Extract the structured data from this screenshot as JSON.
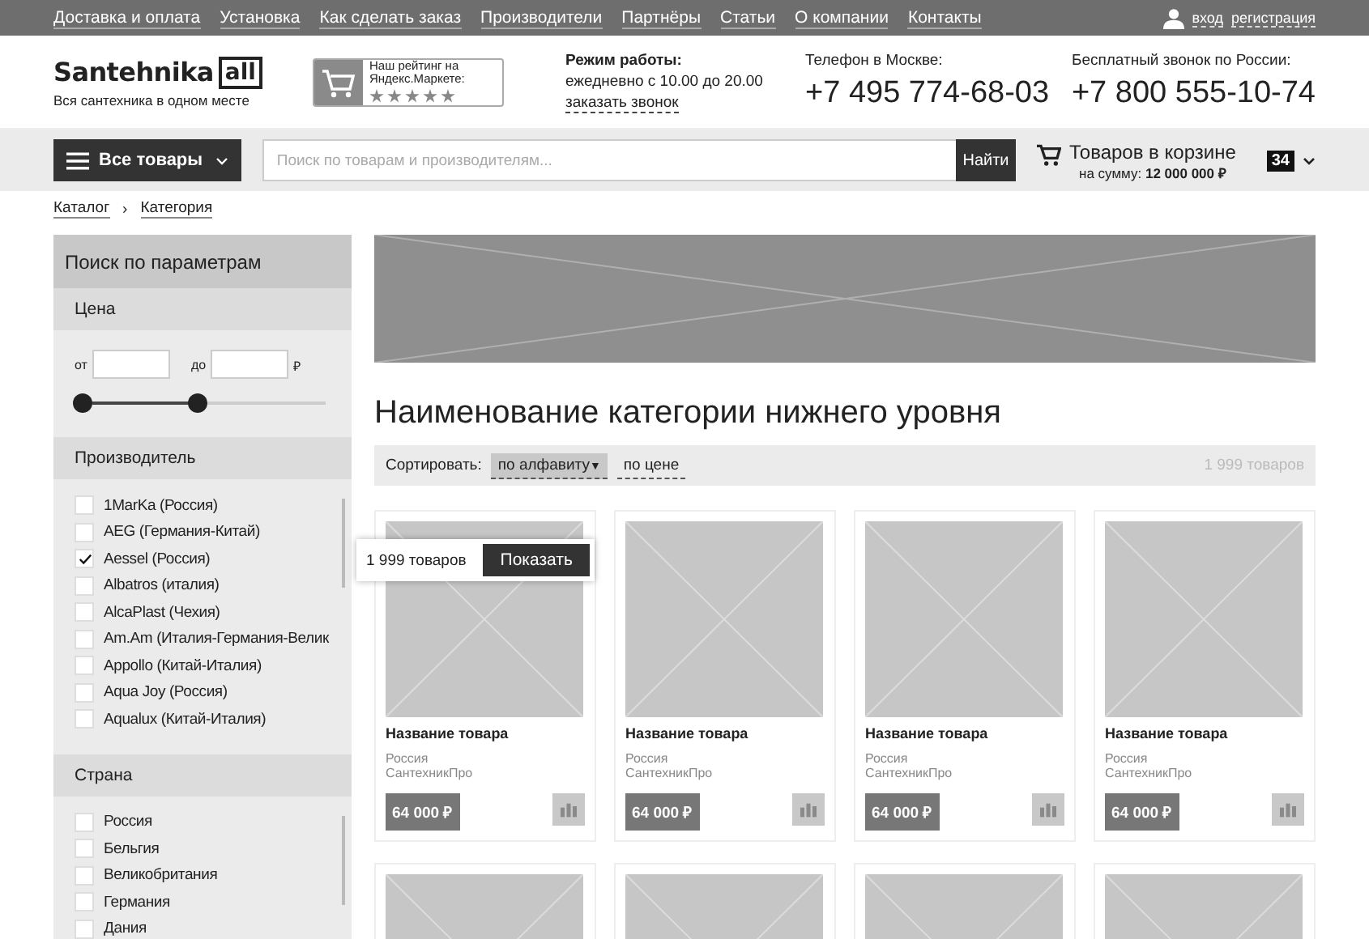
{
  "top_nav": {
    "links": [
      "Доставка и оплата",
      "Установка",
      "Как сделать заказ",
      "Производители",
      "Партнёры",
      "Статьи",
      "О компании",
      "Контакты"
    ],
    "login": "вход",
    "register": "регистрация"
  },
  "header": {
    "logo_main": "Santehnika",
    "logo_box": "all",
    "tagline": "Вся сантехника в одном месте",
    "rating_label": "Наш рейтинг на Яндекс.Маркете:",
    "stars": 5,
    "hours_title": "Режим работы:",
    "hours": "ежедневно с 10.00 до 20.00",
    "callback": "заказать звонок",
    "phones": [
      {
        "label": "Телефон в Москве:",
        "number": "+7 495 774-68-03"
      },
      {
        "label": "Бесплатный звонок по России:",
        "number": "+7 800 555-10-74"
      }
    ]
  },
  "toolbar": {
    "catalog_button": "Все товары",
    "search": {
      "placeholder": "Поиск по товарам и производителям..."
    },
    "search_button": "Найти",
    "cart_title": "Товаров в корзине",
    "cart_sum": "на сумму: **12 000 000 ₽**",
    "cart_count": "34"
  },
  "breadcrumbs": [
    "Каталог",
    "›",
    "Категория"
  ],
  "filters": {
    "title": "Поиск по параметрам",
    "price": {
      "title": "Цена",
      "from_label": "от",
      "to_label": "до",
      "currency": "₽",
      "level": 0.47
    },
    "manufacturer": {
      "title": "Производитель",
      "items": [
        {
          "label": "1MarKa (Россия)",
          "checked": false
        },
        {
          "label": "AEG (Германия-Китай)",
          "checked": false
        },
        {
          "label": "Aessel (Россия)",
          "checked": true
        },
        {
          "label": "Albatros (италия)",
          "checked": false
        },
        {
          "label": "AlcaPlast (Чехия)",
          "checked": false
        },
        {
          "label": "Am.Am (Италия-Германия-Велик",
          "checked": false
        },
        {
          "label": "Appollo (Китай-Италия)",
          "checked": false
        },
        {
          "label": "Aqua Joy (Россия)",
          "checked": false
        },
        {
          "label": "Aqualux (Китай-Италия)",
          "checked": false
        }
      ]
    },
    "country": {
      "title": "Страна",
      "items": [
        {
          "label": "Россия",
          "checked": false
        },
        {
          "label": "Бельгия",
          "checked": false
        },
        {
          "label": "Великобритания",
          "checked": false
        },
        {
          "label": "Германия",
          "checked": false
        },
        {
          "label": "Дания",
          "checked": false
        }
      ]
    },
    "popup": {
      "count": "1 999 товаров",
      "button": "Показать"
    }
  },
  "content": {
    "title": "Наименование категории нижнего уровня",
    "sort": {
      "label": "Сортировать:",
      "options": [
        {
          "label": "по алфавиту",
          "selected": true,
          "caret": "▼"
        },
        {
          "label": "по цене",
          "selected": false
        }
      ],
      "total": "1 999 товаров"
    },
    "products": [
      {
        "kind": "full",
        "name": "Название товара",
        "country": "Россия",
        "brand": "СантехникПро",
        "price": "64 000 ₽"
      },
      {
        "kind": "full",
        "name": "Название товара",
        "country": "Россия",
        "brand": "СантехникПро",
        "price": "64 000 ₽"
      },
      {
        "kind": "full",
        "name": "Название товара",
        "country": "Россия",
        "brand": "СантехникПро",
        "price": "64 000 ₽"
      },
      {
        "kind": "full",
        "name": "Название товара",
        "country": "Россия",
        "brand": "СантехникПро",
        "price": "64 000 ₽"
      },
      {
        "kind": "image_only"
      },
      {
        "kind": "image_only"
      },
      {
        "kind": "image_only"
      },
      {
        "kind": "image_only"
      }
    ]
  }
}
